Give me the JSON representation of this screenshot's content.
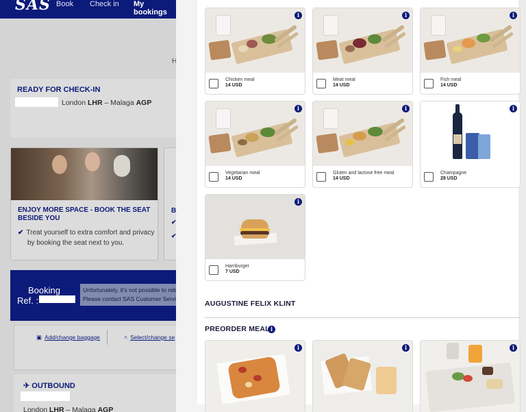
{
  "nav": {
    "logo": "SAS",
    "links": [
      "Book",
      "Check in",
      "My bookings"
    ]
  },
  "background": {
    "crumb_letter": "H",
    "checkin_card": {
      "title": "READY FOR CHECK-IN",
      "route_from": "London ",
      "from_code": "LHR",
      "route_dash": " – Malaga ",
      "to_code": "AGP"
    },
    "promo": {
      "title": "ENJOY MORE SPACE - BOOK THE SEAT BESIDE YOU",
      "line1": "Treat yourself to extra comfort and privacy",
      "line2": "by booking the seat next to you."
    },
    "promo2_letter": "B",
    "booking": {
      "label_line1": "Booking",
      "label_line2": "Ref. :",
      "message_line1": "Unfortunately, it's not possible to rebo",
      "message_line2": "Please contact SAS Customer Service"
    },
    "actions": {
      "baggage": "Add/change baggage",
      "seat": "Select/change se"
    },
    "outbound": {
      "title": "OUTBOUND",
      "route_from": "London ",
      "from_code": "LHR",
      "route_dash": " – Malaga ",
      "to_code": "AGP"
    }
  },
  "modal": {
    "items": [
      {
        "name": "Chicken meal",
        "price": "14 USD"
      },
      {
        "name": "Meat meal",
        "price": "14 USD"
      },
      {
        "name": "Fish meal",
        "price": "14 USD"
      },
      {
        "name": "Vegetarian meal",
        "price": "14 USD"
      },
      {
        "name": "Gluten and lactose free meal",
        "price": "14 USD"
      },
      {
        "name": "Champagne",
        "price": "28 USD"
      },
      {
        "name": "Hamburger",
        "price": "7 USD"
      }
    ],
    "passenger_name": "AUGUSTINE FELIX KLINT",
    "preorder_title": "PREORDER MEALS",
    "info_glyph": "i"
  },
  "colors": {
    "brand": "#0c1a7a",
    "info": "#0c1a7a"
  }
}
